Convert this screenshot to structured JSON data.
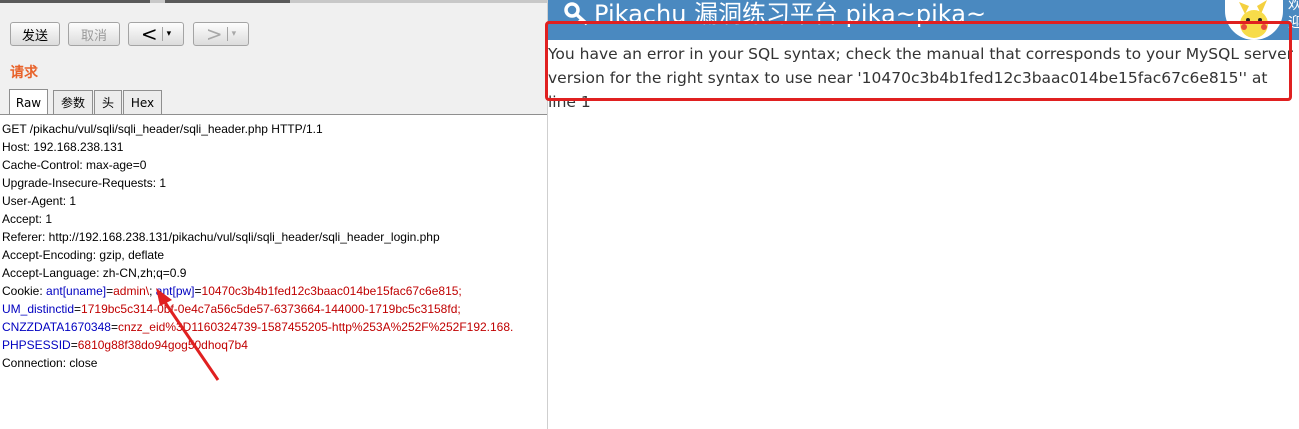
{
  "toolbar": {
    "send_label": "发送",
    "cancel_label": "取消",
    "back_arrow": "<",
    "forward_arrow": ">",
    "dropdown_glyph": "▾"
  },
  "request": {
    "section_label": "请求",
    "tabs": [
      "Raw",
      "参数",
      "头",
      "Hex"
    ],
    "active_tab": "Raw",
    "lines": [
      "GET /pikachu/vul/sqli/sqli_header/sqli_header.php HTTP/1.1",
      "Host: 192.168.238.131",
      "Cache-Control: max-age=0",
      "Upgrade-Insecure-Requests: 1",
      "User-Agent: 1",
      "Accept:  1",
      "Referer: http://192.168.238.131/pikachu/vul/sqli/sqli_header/sqli_header_login.php",
      "Accept-Encoding: gzip, deflate",
      "Accept-Language: zh-CN,zh;q=0.9"
    ],
    "cookie": {
      "prefix": "Cookie: ",
      "k1": "ant[uname]",
      "eq1": "=",
      "v1": "admin\\",
      "sep1": "; ",
      "k2": "ant[pw]",
      "eq2": "=",
      "v2": "10470c3b4b1fed12c3baac014be15fac67c6e815;",
      "k3": "UM_distinctid",
      "eq3": "=",
      "v3": "1719bc5c314-0bf-0e4c7a56c5de57-6373664-144000-1719bc5c3158fd;",
      "k4": "CNZZDATA1670348",
      "eq4": "=",
      "v4": "cnzz_eid%3D1160324739-1587455205-http%253A%252F%252F192.168.",
      "k5": "PHPSESSID",
      "eq5": "=",
      "v5": "6810g88f38do94gog50dhoq7b4"
    },
    "last_line": "Connection: close"
  },
  "browser": {
    "banner_title": "Pikachu 漏洞练习平台 pika~pika~",
    "banner_side_text": "欢\n迎",
    "error_message": "You have an error in your SQL syntax; check the manual that corresponds to your MySQL server version for the right syntax to use near '10470c3b4b1fed12c3baac014be15fac67c6e815'' at line 1"
  },
  "colors": {
    "banner": "#4a89c0",
    "highlight_box": "#e02020",
    "cookie_key": "#0000c0",
    "cookie_value": "#c00000",
    "section_label": "#e8622a"
  }
}
